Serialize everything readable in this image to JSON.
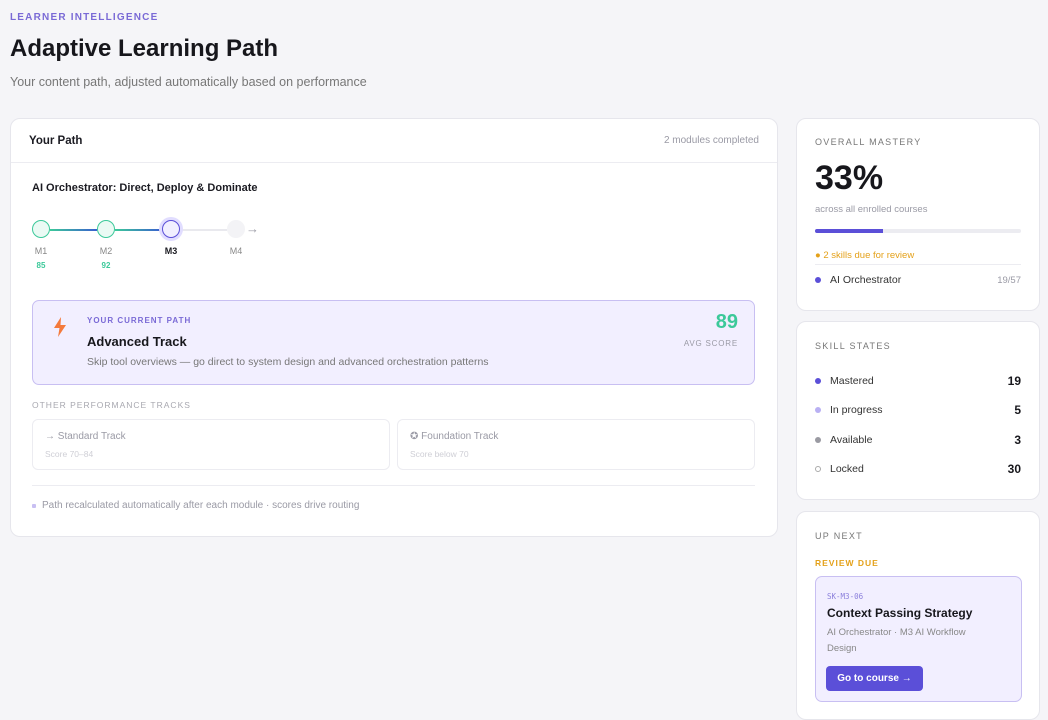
{
  "header": {
    "eyebrow": "LEARNER INTELLIGENCE",
    "title": "Adaptive Learning Path",
    "subtitle": "Your content path, adjusted automatically based on performance"
  },
  "path": {
    "title": "Your Path",
    "completed": "2 modules completed",
    "course": "AI Orchestrator: Direct, Deploy & Dominate",
    "modules": [
      {
        "label": "M1",
        "score": "85",
        "status": "completed"
      },
      {
        "label": "M2",
        "score": "92",
        "status": "completed"
      },
      {
        "label": "M3",
        "score": "",
        "status": "current"
      },
      {
        "label": "M4",
        "score": "",
        "status": "locked"
      }
    ],
    "current": {
      "eyebrow": "YOUR CURRENT PATH",
      "name": "Advanced Track",
      "description": "Skip tool overviews — go direct to system design and advanced orchestration patterns",
      "score": "89",
      "score_label": "AVG SCORE",
      "icon": "lightning-icon"
    },
    "other_label": "OTHER PERFORMANCE TRACKS",
    "other_tracks": [
      {
        "name": "→ Standard Track",
        "range": "Score 70–84"
      },
      {
        "name": "✪ Foundation Track",
        "range": "Score below 70"
      }
    ],
    "footnote": "Path recalculated automatically after each module · scores drive routing"
  },
  "mastery": {
    "label": "OVERALL MASTERY",
    "value": "33%",
    "progress": 0.33,
    "sub": "across all enrolled courses",
    "due": "● 2 skills due for review",
    "course_name": "AI Orchestrator",
    "course_count": "19/57"
  },
  "skills": {
    "label": "SKILL STATES",
    "items": [
      {
        "name": "Mastered",
        "value": "19",
        "color": "#5b4fd8"
      },
      {
        "name": "In progress",
        "value": "5",
        "color": "#b9b0f3"
      },
      {
        "name": "Available",
        "value": "3",
        "color": "#9a9aa2"
      },
      {
        "name": "Locked",
        "value": "30",
        "color": "#ffffff"
      }
    ]
  },
  "next": {
    "label": "UP NEXT",
    "review": "REVIEW DUE",
    "code": "SK-M3-06",
    "name": "Context Passing Strategy",
    "meta": "AI Orchestrator · M3 AI Workflow Design",
    "button": "Go to course →"
  },
  "colors": {
    "accent": "#5b4fd8",
    "success": "#3cc99a",
    "warning": "#e4a11a"
  }
}
